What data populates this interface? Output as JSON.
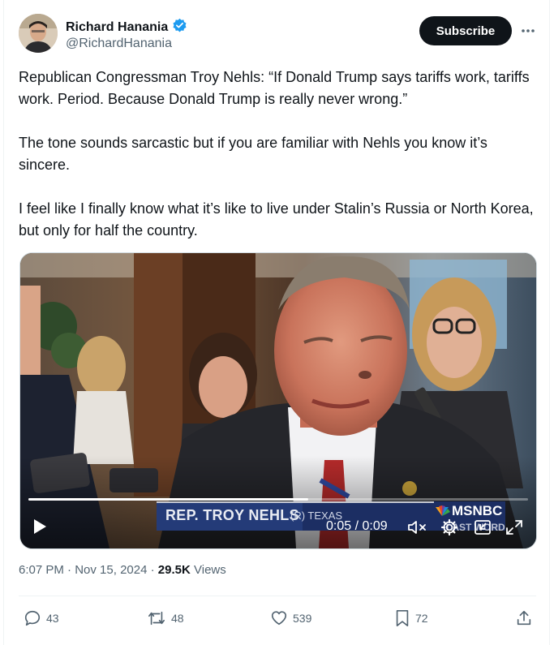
{
  "author": {
    "name": "Richard Hanania",
    "handle": "@RichardHanania",
    "verified": true
  },
  "header": {
    "subscribe_label": "Subscribe",
    "more_icon": "more-horizontal-icon"
  },
  "tweet": {
    "paragraphs": [
      "Republican Congressman Troy Nehls: “If Donald Trump says tariffs work, tariffs work. Period. Because Donald Trump is really never wrong.”",
      "The tone sounds sarcastic but if you are familiar with Nehls you know it’s sincere.",
      "I feel like I finally know what it’s like to live under Stalin’s Russia or North Korea, but only for half the country."
    ]
  },
  "video": {
    "chyron_name": "REP. TROY NEHLS",
    "chyron_party": "(R) TEXAS",
    "network": "MSNBC",
    "network_sub": "LAST WORD",
    "time_display": "0:05 / 0:09",
    "progress": 0.56,
    "colors": {
      "chyron_bg": "#1c2e63",
      "chyron_border": "#c8cbd4"
    }
  },
  "meta": {
    "time": "6:07 PM",
    "date": "Nov 15, 2024",
    "views_count": "29.5K",
    "views_label": "Views"
  },
  "actions": {
    "replies": "43",
    "reposts": "48",
    "likes": "539",
    "bookmarks": "72"
  }
}
